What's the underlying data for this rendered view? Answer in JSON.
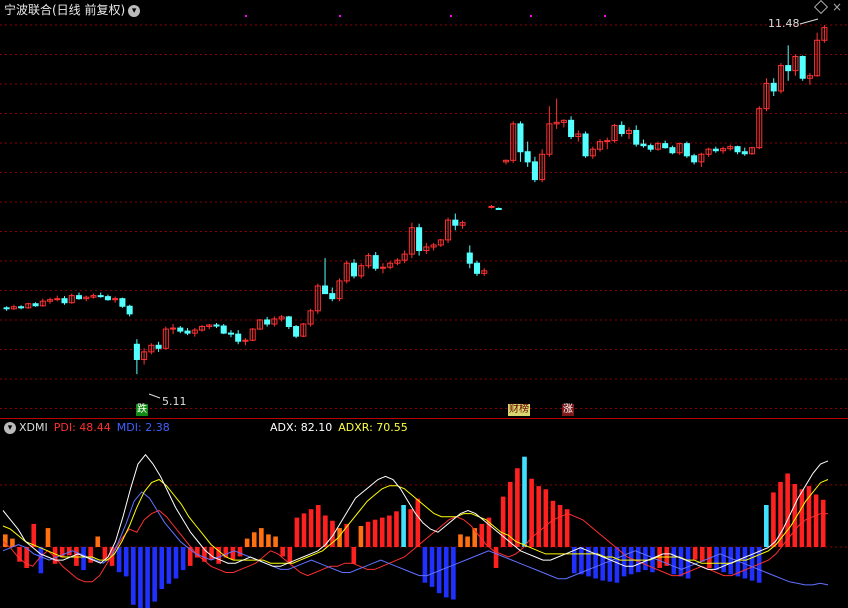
{
  "header": {
    "title": "宁波联合(日线 前复权)",
    "high_label": "11.48",
    "low_label": "5.11"
  },
  "badges": {
    "die": "跌",
    "bang": "财榜",
    "zhang": "涨"
  },
  "indicator": {
    "name": "XDMI",
    "pdi_label": "PDI: 48.44",
    "mdi_label": "MDI: 2.38",
    "adx_label": "ADX: 82.10",
    "adxr_label": "ADXR: 70.55"
  },
  "colors": {
    "up": "#ff3232",
    "down": "#54ffff",
    "pdi": "#ff3030",
    "mdi": "#3030ff",
    "adx": "#ffffff",
    "adxr": "#ffff00",
    "grid": "#8b0000"
  },
  "chart_data": {
    "type": "candlestick",
    "price_range": [
      4.6,
      12.1
    ],
    "candles": [
      [
        6.42,
        6.45,
        6.36,
        6.4
      ],
      [
        6.4,
        6.48,
        6.38,
        6.44
      ],
      [
        6.44,
        6.47,
        6.39,
        6.42
      ],
      [
        6.42,
        6.52,
        6.4,
        6.5
      ],
      [
        6.5,
        6.53,
        6.44,
        6.46
      ],
      [
        6.46,
        6.6,
        6.44,
        6.55
      ],
      [
        6.55,
        6.62,
        6.5,
        6.58
      ],
      [
        6.58,
        6.66,
        6.55,
        6.6
      ],
      [
        6.6,
        6.65,
        6.48,
        6.52
      ],
      [
        6.52,
        6.7,
        6.5,
        6.66
      ],
      [
        6.66,
        6.72,
        6.58,
        6.6
      ],
      [
        6.6,
        6.66,
        6.55,
        6.63
      ],
      [
        6.63,
        6.7,
        6.6,
        6.66
      ],
      [
        6.66,
        6.72,
        6.62,
        6.64
      ],
      [
        6.64,
        6.68,
        6.56,
        6.58
      ],
      [
        6.58,
        6.64,
        6.52,
        6.6
      ],
      [
        6.6,
        6.62,
        6.42,
        6.45
      ],
      [
        6.45,
        6.48,
        6.25,
        6.3
      ],
      [
        5.7,
        5.8,
        5.11,
        5.4
      ],
      [
        5.4,
        5.62,
        5.3,
        5.55
      ],
      [
        5.55,
        5.72,
        5.5,
        5.68
      ],
      [
        5.68,
        5.75,
        5.55,
        5.62
      ],
      [
        5.62,
        6.05,
        5.6,
        6.0
      ],
      [
        6.0,
        6.1,
        5.9,
        6.02
      ],
      [
        6.02,
        6.06,
        5.92,
        5.96
      ],
      [
        5.96,
        6.02,
        5.88,
        5.92
      ],
      [
        5.92,
        6.02,
        5.85,
        5.98
      ],
      [
        5.98,
        6.08,
        5.95,
        6.05
      ],
      [
        6.05,
        6.1,
        6.0,
        6.08
      ],
      [
        6.08,
        6.12,
        6.02,
        6.06
      ],
      [
        6.06,
        6.1,
        5.9,
        5.92
      ],
      [
        5.92,
        5.98,
        5.84,
        5.9
      ],
      [
        5.9,
        5.98,
        5.7,
        5.76
      ],
      [
        5.76,
        5.82,
        5.68,
        5.78
      ],
      [
        5.78,
        6.02,
        5.76,
        6.0
      ],
      [
        6.0,
        6.2,
        5.98,
        6.18
      ],
      [
        6.18,
        6.24,
        6.05,
        6.1
      ],
      [
        6.1,
        6.25,
        6.05,
        6.2
      ],
      [
        6.2,
        6.28,
        6.15,
        6.24
      ],
      [
        6.24,
        6.26,
        6.0,
        6.05
      ],
      [
        6.05,
        6.08,
        5.82,
        5.86
      ],
      [
        5.86,
        6.12,
        5.84,
        6.1
      ],
      [
        6.1,
        6.4,
        6.05,
        6.36
      ],
      [
        6.36,
        6.9,
        6.3,
        6.85
      ],
      [
        6.85,
        7.4,
        6.8,
        6.7
      ],
      [
        6.7,
        6.82,
        6.55,
        6.6
      ],
      [
        6.6,
        7.0,
        6.55,
        6.95
      ],
      [
        6.95,
        7.35,
        6.9,
        7.3
      ],
      [
        7.3,
        7.38,
        7.0,
        7.05
      ],
      [
        7.05,
        7.3,
        7.0,
        7.25
      ],
      [
        7.25,
        7.5,
        7.2,
        7.45
      ],
      [
        7.45,
        7.52,
        7.15,
        7.2
      ],
      [
        7.2,
        7.3,
        7.1,
        7.22
      ],
      [
        7.22,
        7.34,
        7.18,
        7.3
      ],
      [
        7.3,
        7.4,
        7.26,
        7.36
      ],
      [
        7.36,
        7.55,
        7.3,
        7.48
      ],
      [
        7.48,
        8.1,
        7.4,
        8.0
      ],
      [
        8.0,
        8.08,
        7.45,
        7.55
      ],
      [
        7.55,
        7.7,
        7.48,
        7.62
      ],
      [
        7.62,
        7.7,
        7.55,
        7.66
      ],
      [
        7.66,
        7.78,
        7.62,
        7.76
      ],
      [
        7.76,
        8.2,
        7.7,
        8.15
      ],
      [
        8.15,
        8.28,
        7.95,
        8.05
      ],
      [
        8.05,
        8.14,
        7.98,
        8.1
      ],
      [
        7.5,
        7.65,
        7.2,
        7.3
      ],
      [
        7.3,
        7.35,
        7.05,
        7.1
      ],
      [
        7.1,
        7.2,
        7.05,
        7.15
      ],
      [
        8.4,
        8.45,
        8.38,
        8.42
      ],
      [
        8.38,
        8.4,
        8.35,
        8.37
      ],
      [
        9.3,
        9.35,
        9.25,
        9.33
      ],
      [
        9.33,
        10.1,
        9.28,
        10.05
      ],
      [
        10.05,
        10.1,
        9.3,
        9.5
      ],
      [
        9.5,
        9.7,
        9.2,
        9.3
      ],
      [
        9.3,
        9.4,
        8.9,
        8.95
      ],
      [
        8.95,
        9.55,
        8.9,
        9.45
      ],
      [
        9.45,
        10.4,
        9.4,
        10.05
      ],
      [
        10.05,
        10.55,
        9.95,
        10.08
      ],
      [
        10.08,
        10.14,
        9.98,
        10.12
      ],
      [
        10.12,
        10.2,
        9.75,
        9.8
      ],
      [
        9.8,
        9.92,
        9.7,
        9.85
      ],
      [
        9.85,
        9.9,
        9.38,
        9.42
      ],
      [
        9.42,
        9.6,
        9.36,
        9.55
      ],
      [
        9.55,
        9.75,
        9.5,
        9.7
      ],
      [
        9.7,
        9.78,
        9.55,
        9.72
      ],
      [
        9.72,
        10.05,
        9.68,
        10.02
      ],
      [
        10.02,
        10.1,
        9.8,
        9.86
      ],
      [
        9.86,
        9.98,
        9.75,
        9.92
      ],
      [
        9.92,
        10.02,
        9.6,
        9.65
      ],
      [
        9.65,
        9.74,
        9.58,
        9.62
      ],
      [
        9.62,
        9.66,
        9.5,
        9.55
      ],
      [
        9.55,
        9.7,
        9.52,
        9.66
      ],
      [
        9.66,
        9.72,
        9.56,
        9.58
      ],
      [
        9.58,
        9.62,
        9.45,
        9.48
      ],
      [
        9.48,
        9.68,
        9.44,
        9.66
      ],
      [
        9.66,
        9.7,
        9.38,
        9.42
      ],
      [
        9.42,
        9.46,
        9.25,
        9.3
      ],
      [
        9.3,
        9.48,
        9.2,
        9.45
      ],
      [
        9.45,
        9.58,
        9.4,
        9.55
      ],
      [
        9.55,
        9.6,
        9.48,
        9.52
      ],
      [
        9.52,
        9.6,
        9.46,
        9.56
      ],
      [
        9.56,
        9.64,
        9.52,
        9.6
      ],
      [
        9.6,
        9.62,
        9.45,
        9.5
      ],
      [
        9.5,
        9.58,
        9.42,
        9.46
      ],
      [
        9.46,
        9.6,
        9.44,
        9.58
      ],
      [
        9.58,
        10.4,
        9.55,
        10.35
      ],
      [
        10.35,
        10.95,
        10.3,
        10.85
      ],
      [
        10.85,
        10.95,
        10.6,
        10.7
      ],
      [
        10.7,
        11.25,
        10.65,
        11.2
      ],
      [
        11.2,
        11.6,
        10.9,
        11.1
      ],
      [
        11.1,
        11.42,
        11.0,
        11.38
      ],
      [
        11.38,
        11.4,
        10.9,
        10.95
      ],
      [
        10.95,
        11.05,
        10.82,
        11.0
      ],
      [
        11.0,
        11.85,
        10.98,
        11.7
      ],
      [
        11.7,
        12.0,
        11.65,
        11.95
      ]
    ],
    "dmi": {
      "histogram": [
        12,
        8,
        -14,
        -20,
        22,
        -25,
        18,
        -16,
        -10,
        -8,
        -18,
        -22,
        -15,
        10,
        -12,
        -18,
        -24,
        -28,
        -55,
        -58,
        -60,
        -52,
        -40,
        -35,
        -30,
        -22,
        -18,
        -10,
        -14,
        -12,
        -16,
        -10,
        -12,
        -9,
        8,
        14,
        18,
        12,
        10,
        -9,
        -15,
        28,
        32,
        36,
        40,
        30,
        25,
        18,
        22,
        -16,
        20,
        24,
        26,
        28,
        30,
        34,
        40,
        36,
        46,
        -34,
        -38,
        -44,
        -48,
        -50,
        12,
        10,
        18,
        22,
        28,
        -20,
        48,
        62,
        75,
        86,
        65,
        58,
        55,
        44,
        40,
        36,
        -25,
        -26,
        -28,
        -30,
        -32,
        -33,
        -34,
        -28,
        -26,
        -24,
        -22,
        -24,
        -20,
        -18,
        -26,
        -28,
        -30,
        -12,
        -14,
        -20,
        -22,
        -24,
        -26,
        -28,
        -30,
        -32,
        -34,
        40,
        52,
        62,
        70,
        60,
        55,
        58,
        50,
        45
      ],
      "pdi": [
        30,
        26,
        20,
        16,
        14,
        20,
        24,
        20,
        14,
        10,
        6,
        4,
        4,
        8,
        16,
        24,
        32,
        38,
        36,
        44,
        48,
        50,
        46,
        40,
        34,
        28,
        22,
        18,
        14,
        12,
        10,
        10,
        12,
        14,
        16,
        20,
        24,
        22,
        18,
        14,
        10,
        8,
        10,
        12,
        14,
        14,
        16,
        16,
        14,
        12,
        12,
        14,
        16,
        18,
        20,
        24,
        28,
        32,
        36,
        40,
        44,
        46,
        44,
        40,
        34,
        28,
        24,
        22,
        20,
        22,
        26,
        32,
        36,
        40,
        44,
        46,
        48,
        46,
        44,
        40,
        36,
        32,
        28,
        24,
        20,
        18,
        16,
        14,
        12,
        10,
        8,
        8,
        10,
        12,
        14,
        12,
        10,
        8,
        8,
        10,
        12,
        14,
        16,
        18,
        22,
        28,
        34,
        40,
        44,
        46,
        48,
        48
      ],
      "mdi": [
        24,
        26,
        28,
        26,
        22,
        20,
        18,
        20,
        22,
        24,
        22,
        20,
        18,
        16,
        20,
        30,
        42,
        56,
        62,
        58,
        50,
        42,
        36,
        30,
        26,
        22,
        20,
        18,
        20,
        22,
        24,
        22,
        20,
        18,
        16,
        14,
        12,
        12,
        14,
        16,
        18,
        16,
        14,
        12,
        10,
        10,
        12,
        14,
        16,
        18,
        16,
        14,
        12,
        10,
        8,
        8,
        10,
        12,
        14,
        16,
        18,
        20,
        22,
        24,
        22,
        20,
        18,
        16,
        14,
        12,
        10,
        8,
        6,
        6,
        8,
        10,
        12,
        14,
        16,
        18,
        20,
        22,
        24,
        22,
        20,
        18,
        16,
        14,
        12,
        14,
        16,
        18,
        20,
        22,
        20,
        18,
        16,
        14,
        12,
        10,
        8,
        6,
        4,
        3,
        2,
        2,
        3,
        2
      ],
      "adx": [
        50,
        44,
        38,
        30,
        26,
        22,
        20,
        18,
        18,
        20,
        22,
        20,
        18,
        16,
        20,
        30,
        46,
        64,
        80,
        86,
        80,
        72,
        62,
        52,
        44,
        36,
        30,
        24,
        20,
        18,
        16,
        16,
        18,
        20,
        18,
        16,
        14,
        14,
        16,
        18,
        20,
        22,
        24,
        28,
        34,
        42,
        50,
        58,
        62,
        66,
        70,
        72,
        70,
        64,
        56,
        48,
        42,
        38,
        36,
        40,
        44,
        48,
        50,
        48,
        44,
        40,
        36,
        32,
        28,
        24,
        22,
        20,
        18,
        18,
        20,
        22,
        24,
        26,
        24,
        22,
        20,
        18,
        16,
        14,
        14,
        16,
        18,
        20,
        22,
        22,
        20,
        18,
        16,
        14,
        12,
        12,
        14,
        16,
        18,
        20,
        22,
        24,
        26,
        30,
        38,
        48,
        58,
        66,
        74,
        80,
        82
      ],
      "adxr": [
        40,
        38,
        34,
        30,
        28,
        26,
        24,
        22,
        20,
        20,
        20,
        20,
        20,
        18,
        18,
        22,
        30,
        40,
        52,
        62,
        68,
        70,
        66,
        60,
        54,
        46,
        40,
        34,
        28,
        24,
        20,
        18,
        18,
        18,
        18,
        18,
        16,
        16,
        16,
        16,
        18,
        20,
        22,
        24,
        28,
        32,
        38,
        44,
        50,
        56,
        60,
        64,
        66,
        66,
        64,
        60,
        56,
        52,
        48,
        46,
        46,
        46,
        48,
        48,
        46,
        44,
        40,
        36,
        34,
        30,
        28,
        26,
        24,
        22,
        22,
        22,
        22,
        22,
        22,
        22,
        22,
        20,
        20,
        18,
        18,
        18,
        18,
        18,
        20,
        20,
        20,
        20,
        18,
        18,
        16,
        16,
        16,
        16,
        16,
        18,
        18,
        20,
        22,
        24,
        28,
        34,
        40,
        48,
        56,
        62,
        68,
        70
      ]
    }
  }
}
